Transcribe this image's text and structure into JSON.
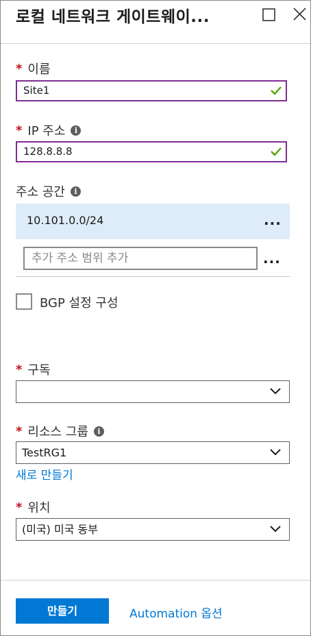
{
  "header": {
    "title": "로컬 네트워크 게이트웨이...",
    "maximize_icon": "maximize-icon",
    "close_icon": "close-icon"
  },
  "form": {
    "name": {
      "label": "이름",
      "required": "*",
      "value": "Site1"
    },
    "ip_address": {
      "label": "IP 주소",
      "required": "*",
      "value": "128.8.8.8"
    },
    "address_space": {
      "label": "주소 공간",
      "entries": [
        "10.101.0.0/24"
      ],
      "more": "...",
      "add_placeholder": "추가 주소 범위 추가"
    },
    "bgp": {
      "label": "BGP 설정 구성",
      "checked": false
    },
    "subscription": {
      "label": "구독",
      "required": "*",
      "value": ""
    },
    "resource_group": {
      "label": "리소스 그룹",
      "required": "*",
      "value": "TestRG1",
      "create_new": "새로 만들기"
    },
    "location": {
      "label": "위치",
      "required": "*",
      "value": "(미국) 미국 동부"
    }
  },
  "footer": {
    "create_button": "만들기",
    "automation_link": "Automation 옵션"
  },
  "colors": {
    "accent": "#0078d4",
    "valid_check": "#57a300",
    "required": "#c50f1f",
    "input_focus_border": "#7e2d8f",
    "selected_row": "#deecf9"
  }
}
